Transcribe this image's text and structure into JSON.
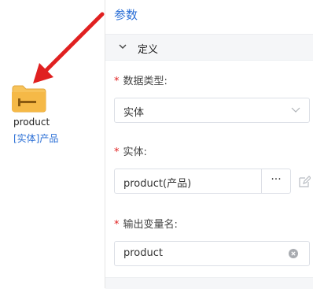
{
  "canvas": {
    "node": {
      "icon": "folder-entity-icon",
      "title": "product",
      "subtitle": "[实体]产品"
    }
  },
  "panel": {
    "title": "参数",
    "section": {
      "label": "定义",
      "expanded": true,
      "icon": "chevron-down-icon"
    },
    "fields": {
      "data_type": {
        "label": "数据类型:",
        "required_mark": "*",
        "value": "实体"
      },
      "entity": {
        "label": "实体:",
        "required_mark": "*",
        "value": "product(产品)",
        "browse_label": "···"
      },
      "output_var": {
        "label": "输出变量名:",
        "required_mark": "*",
        "value": "product"
      }
    }
  },
  "colors": {
    "accent": "#2b6fd6",
    "required": "#e02020",
    "arrow": "#e02020",
    "folder": "#f0b43c"
  }
}
